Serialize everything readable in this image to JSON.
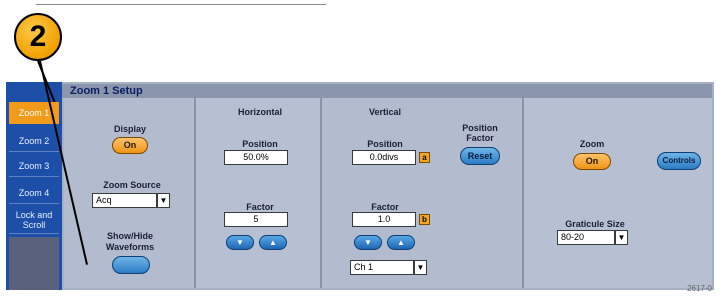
{
  "callout": {
    "number": "2"
  },
  "setup": {
    "title": "Zoom 1 Setup"
  },
  "tabs": [
    {
      "label": "Zoom 1",
      "active": true
    },
    {
      "label": "Zoom 2",
      "active": false
    },
    {
      "label": "Zoom 3",
      "active": false
    },
    {
      "label": "Zoom 4",
      "active": false
    },
    {
      "label": "Lock and Scroll",
      "active": false
    }
  ],
  "display": {
    "label": "Display",
    "button": "On"
  },
  "zoom_source": {
    "label": "Zoom Source",
    "value": "Acq",
    "arrow": "▼"
  },
  "show_hide": {
    "label": "Show/Hide Waveforms"
  },
  "horizontal": {
    "header": "Horizontal",
    "position_label": "Position",
    "position_value": "50.0%",
    "factor_label": "Factor",
    "factor_value": "5",
    "down": "▼",
    "up": "▲"
  },
  "vertical": {
    "header": "Vertical",
    "position_label": "Position",
    "position_value": "0.0divs",
    "position_badge": "a",
    "factor_label": "Factor",
    "factor_value": "1.0",
    "factor_badge": "b",
    "down": "▼",
    "up": "▲",
    "channel_value": "Ch 1",
    "arrow": "▼"
  },
  "position_factor": {
    "label": "Position Factor",
    "button": "Reset"
  },
  "zoom": {
    "label": "Zoom",
    "button": "On"
  },
  "controls": {
    "button": "Controls"
  },
  "graticule": {
    "label": "Graticule Size",
    "value": "80-20",
    "arrow": "▼"
  },
  "figure_number": "2617-0",
  "colors": {
    "accent": "#f29a1a",
    "tab_blue": "#1d4fa9",
    "panel": "#a7b1c6"
  }
}
